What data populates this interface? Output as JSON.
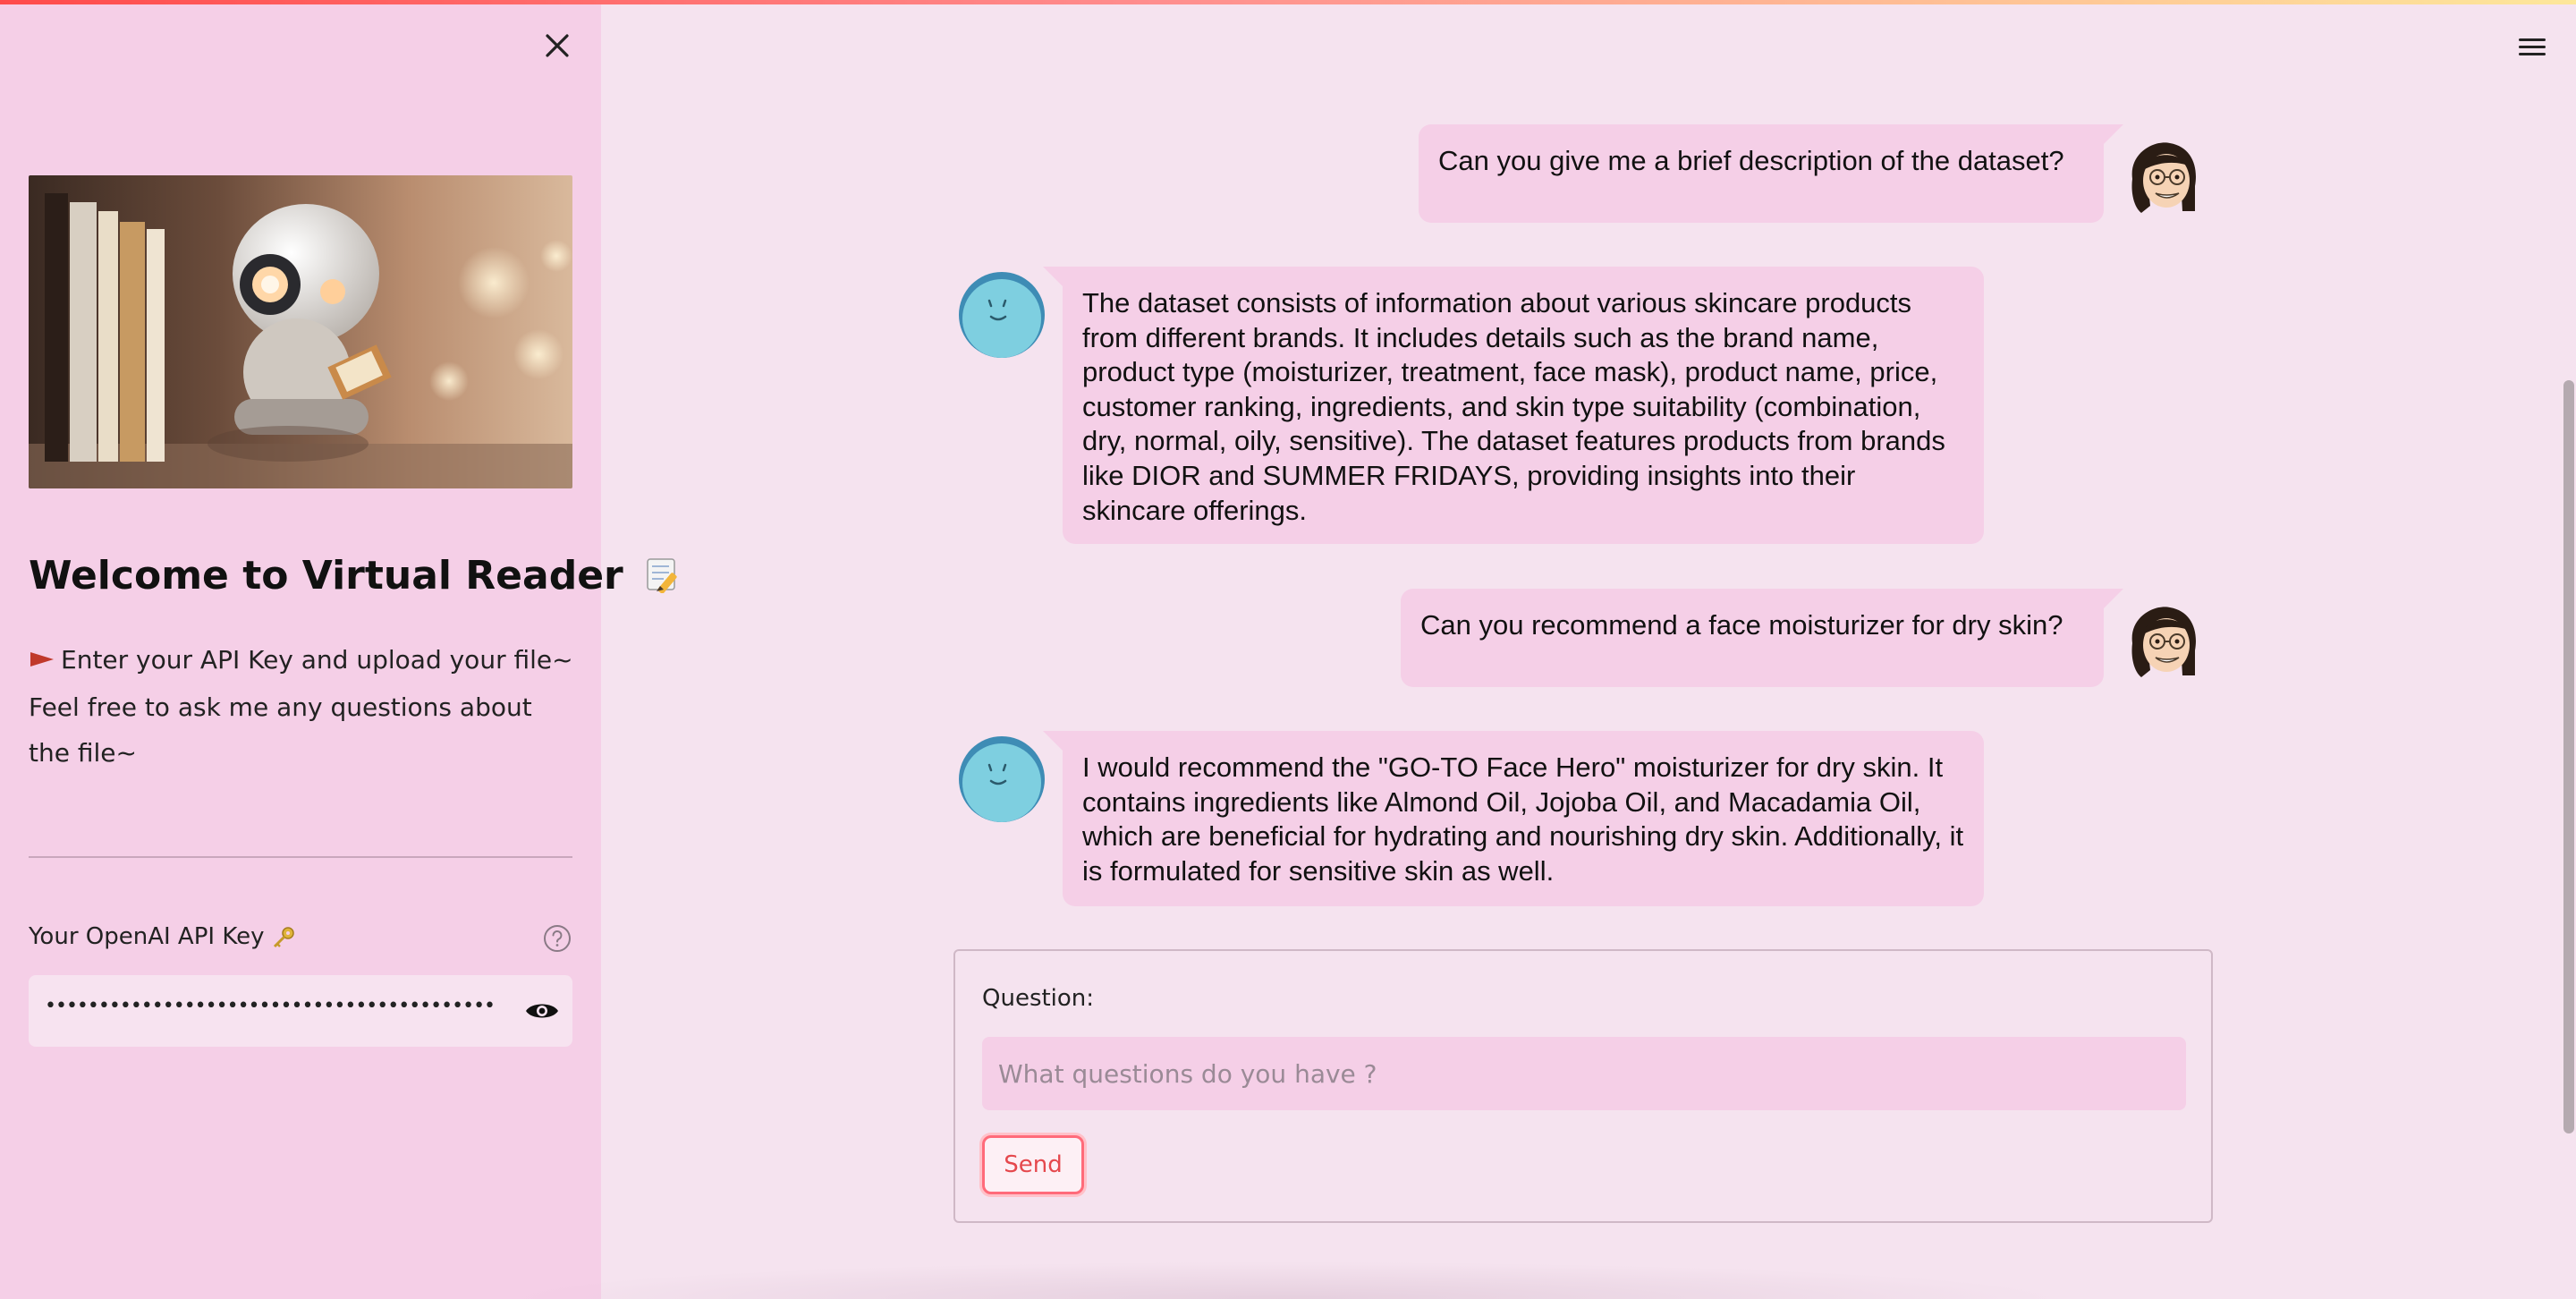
{
  "sidebar": {
    "welcome_title": "Welcome to Virtual Reader",
    "intro_line1": "Enter your API Key and upload your file~",
    "intro_line2": "Feel free to ask me any questions about the file~",
    "api_key_label": "Your OpenAI API Key",
    "api_key_value": "•••••••••••••••••••••••••••••••••••••••••••••••••••"
  },
  "messages": [
    {
      "role": "user",
      "text": "Can you give me a brief description of the dataset?"
    },
    {
      "role": "assistant",
      "text": "The dataset consists of information about various skincare products from different brands. It includes details such as the brand name, product type (moisturizer, treatment, face mask), product name, price, customer ranking, ingredients, and skin type suitability (combination, dry, normal, oily, sensitive). The dataset features products from brands like DIOR and SUMMER FRIDAYS, providing insights into their skincare offerings."
    },
    {
      "role": "user",
      "text": "Can you recommend a face moisturizer for dry skin?"
    },
    {
      "role": "assistant",
      "text": "I would recommend the \"GO-TO Face Hero\" moisturizer for dry skin. It contains ingredients like Almond Oil, Jojoba Oil, and Macadamia Oil, which are beneficial for hydrating and nourishing dry skin. Additionally, it is formulated for sensitive skin as well."
    }
  ],
  "form": {
    "question_label": "Question:",
    "question_placeholder": "What questions do you have ?",
    "send_label": "Send"
  },
  "icons": {
    "close": "close-icon",
    "menu": "hamburger-menu-icon",
    "help": "help-circle-icon",
    "show_password": "eye-icon",
    "flag": "red-flag-icon",
    "memo": "memo-pencil-icon",
    "key": "key-icon"
  },
  "colors": {
    "sidebar_bg": "#f5cfe7",
    "main_bg": "#f5e3ef",
    "bubble_bg": "#f5cfe7",
    "accent": "#ff4b4b"
  }
}
